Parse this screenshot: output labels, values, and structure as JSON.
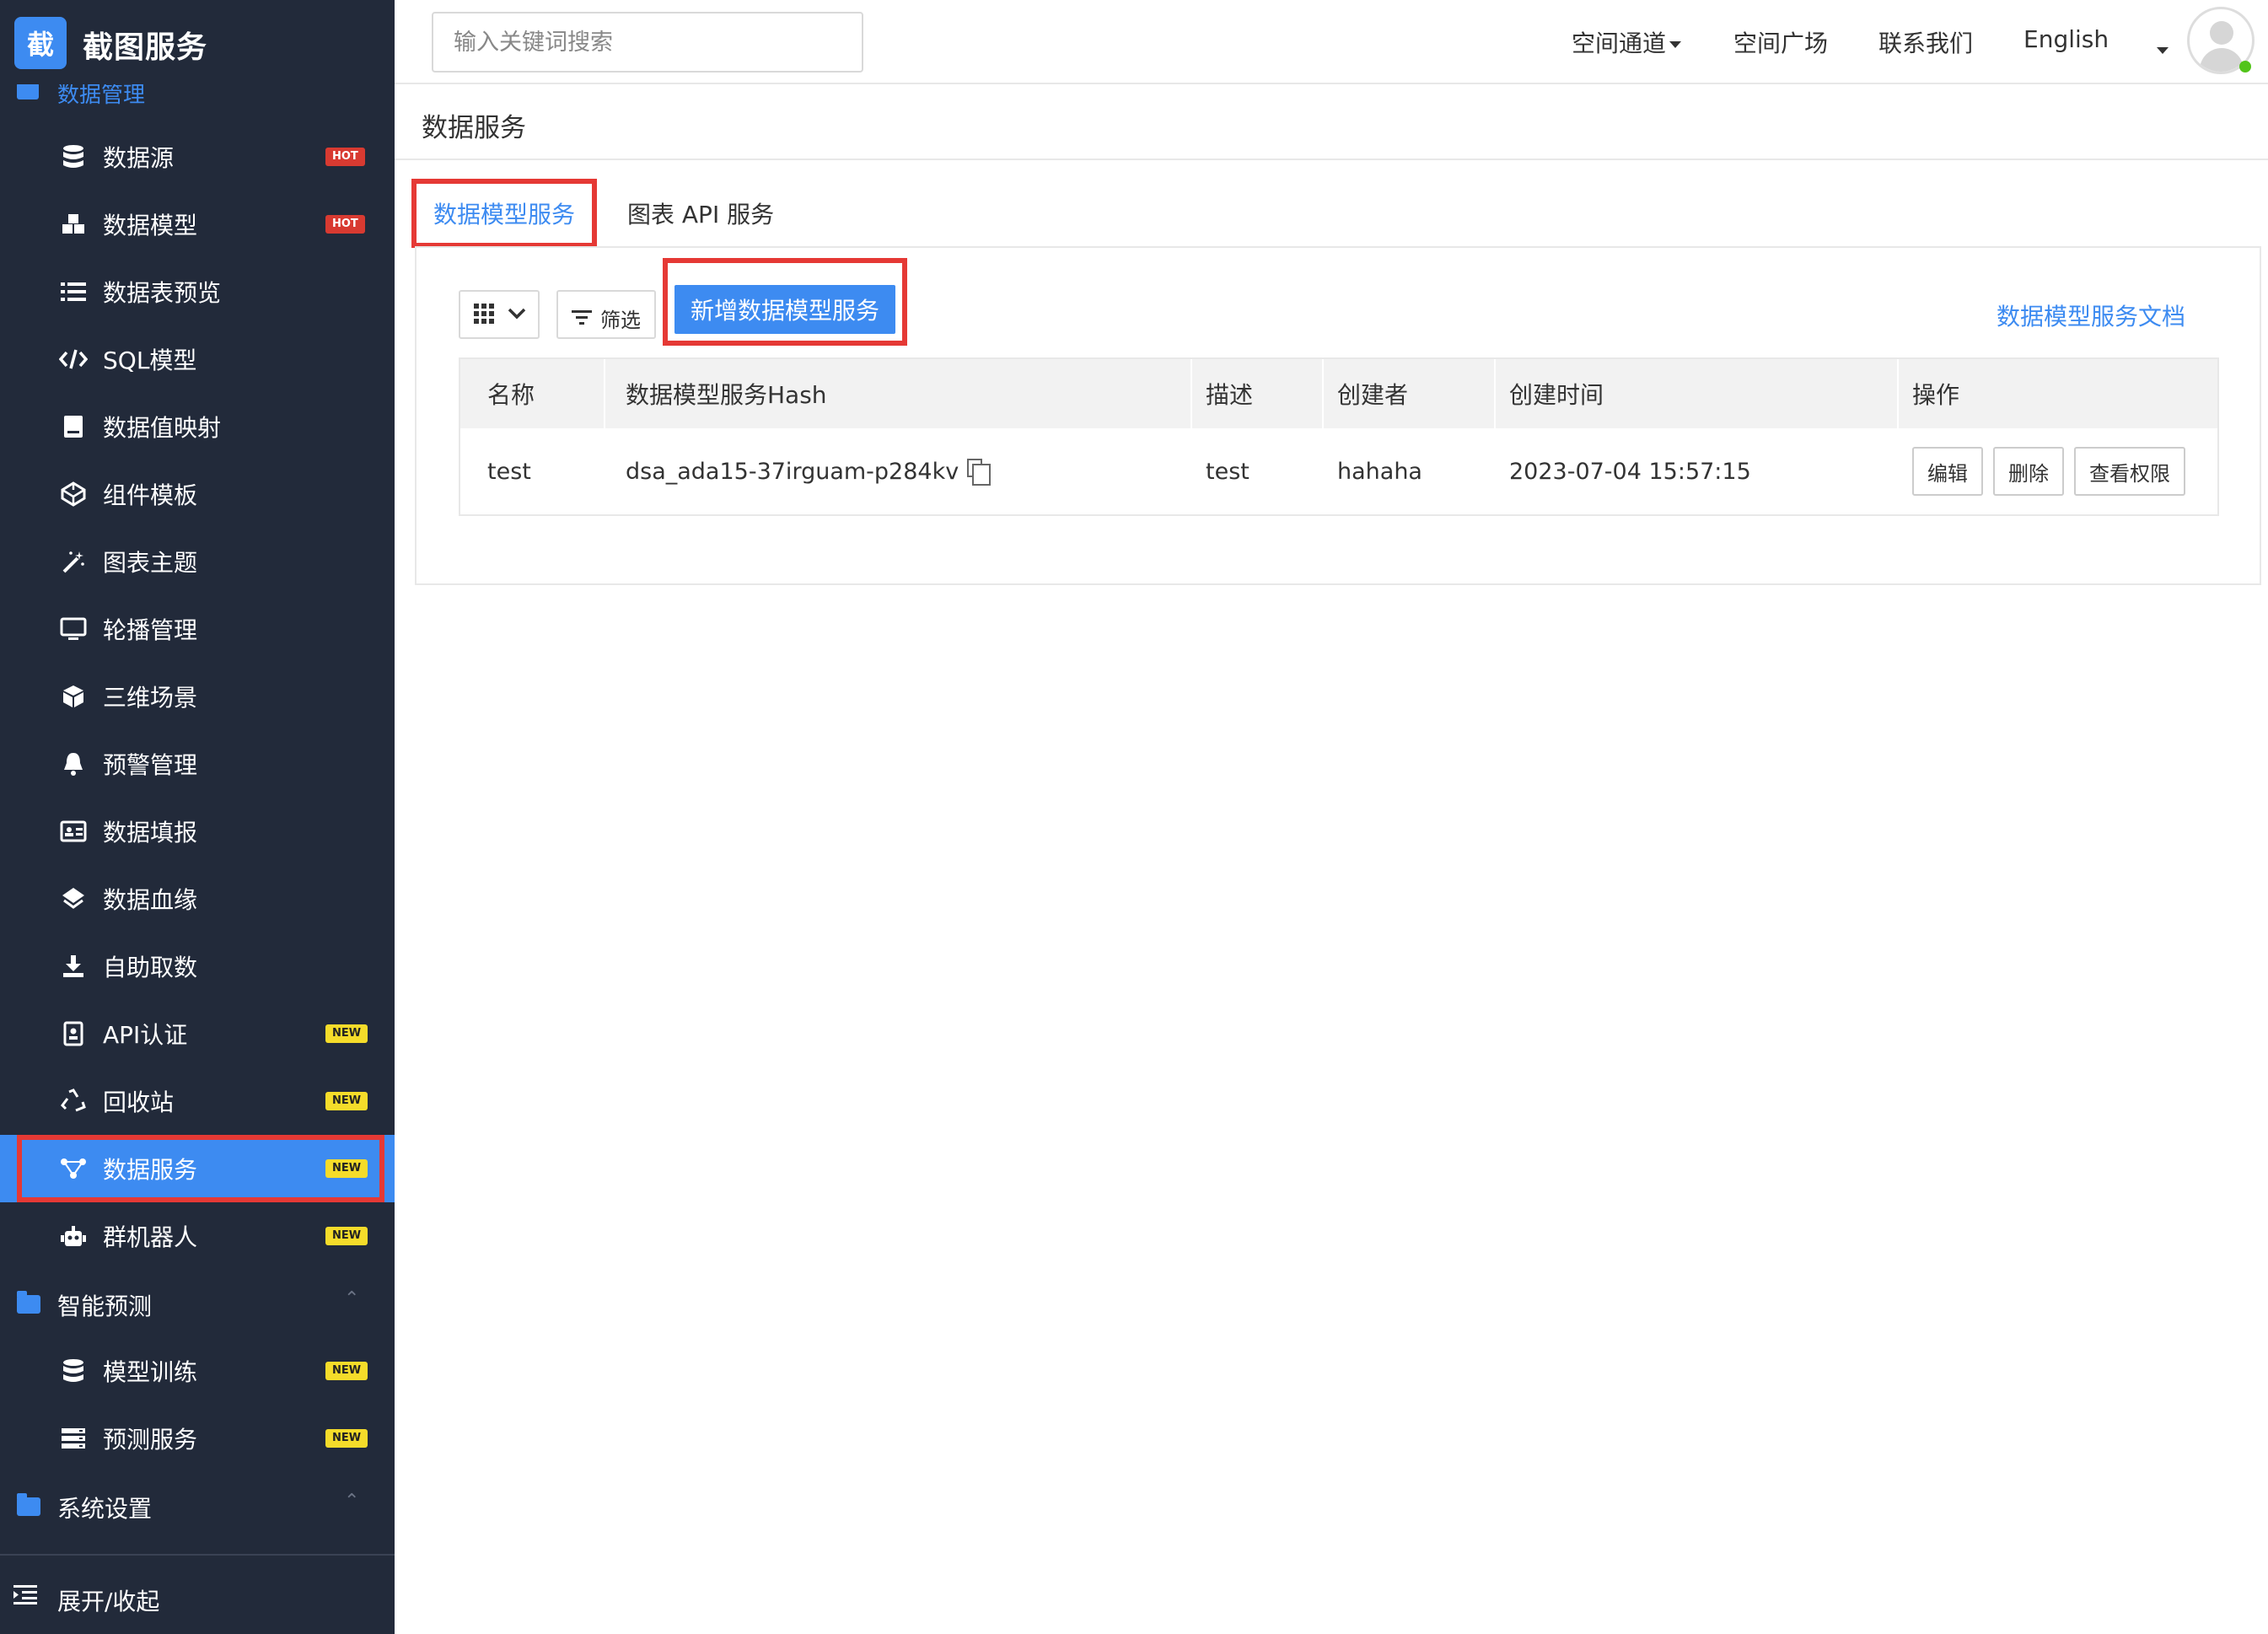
{
  "app": {
    "logo_char": "截",
    "name": "截图服务"
  },
  "sidebar": {
    "partial_group": "数据管理",
    "items": [
      {
        "label": "数据源",
        "badge": "HOT"
      },
      {
        "label": "数据模型",
        "badge": "HOT"
      },
      {
        "label": "数据表预览",
        "badge": ""
      },
      {
        "label": "SQL模型",
        "badge": ""
      },
      {
        "label": "数据值映射",
        "badge": ""
      },
      {
        "label": "组件模板",
        "badge": ""
      },
      {
        "label": "图表主题",
        "badge": ""
      },
      {
        "label": "轮播管理",
        "badge": ""
      },
      {
        "label": "三维场景",
        "badge": ""
      },
      {
        "label": "预警管理",
        "badge": ""
      },
      {
        "label": "数据填报",
        "badge": ""
      },
      {
        "label": "数据血缘",
        "badge": ""
      },
      {
        "label": "自助取数",
        "badge": ""
      },
      {
        "label": "API认证",
        "badge": "NEW"
      },
      {
        "label": "回收站",
        "badge": "NEW"
      },
      {
        "label": "数据服务",
        "badge": "NEW",
        "active": true
      },
      {
        "label": "群机器人",
        "badge": "NEW"
      }
    ],
    "group_predict": "智能预测",
    "predict_items": [
      {
        "label": "模型训练",
        "badge": "NEW"
      },
      {
        "label": "预测服务",
        "badge": "NEW"
      }
    ],
    "group_settings": "系统设置",
    "collapse_label": "展开/收起"
  },
  "header": {
    "search_placeholder": "输入关键词搜索",
    "links": {
      "space_channel": "空间通道",
      "space_plaza": "空间广场",
      "contact": "联系我们",
      "language": "English"
    }
  },
  "page": {
    "title": "数据服务",
    "tabs": [
      "数据模型服务",
      "图表 API 服务"
    ]
  },
  "toolbar": {
    "filter_label": "筛选",
    "add_label": "新增数据模型服务",
    "doc_link": "数据模型服务文档"
  },
  "table": {
    "headers": [
      "名称",
      "数据模型服务Hash",
      "描述",
      "创建者",
      "创建时间",
      "操作"
    ],
    "rows": [
      {
        "name": "test",
        "hash": "dsa_ada15-37irguam-p284kv",
        "desc": "test",
        "creator": "hahaha",
        "created": "2023-07-04 15:57:15",
        "actions": [
          "编辑",
          "删除",
          "查看权限"
        ]
      }
    ]
  },
  "colors": {
    "sidebar_bg": "#222a3a",
    "accent": "#3d8bf1",
    "highlight": "#e53935",
    "hot": "#d83a31",
    "new": "#f5dc2a"
  }
}
